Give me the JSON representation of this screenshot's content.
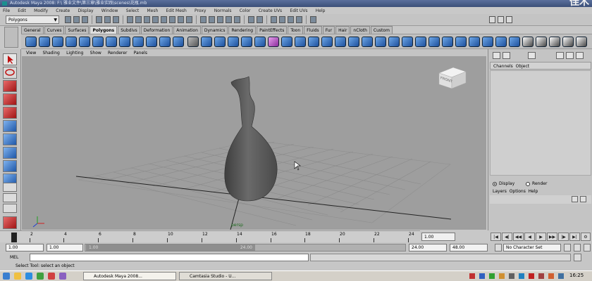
{
  "window": {
    "title": "Autodesk Maya 2008: F:\\ 雅业文件\\第三章\\雅业实践\\scenes\\花瓶.mb",
    "watermark": "佳木"
  },
  "menubar": [
    "File",
    "Edit",
    "Modify",
    "Create",
    "Display",
    "Window",
    "Select",
    "Mesh",
    "Edit Mesh",
    "Proxy",
    "Normals",
    "Color",
    "Create UVs",
    "Edit UVs",
    "Help"
  ],
  "statusline": {
    "menuset": "Polygons"
  },
  "shelf_tabs": [
    "General",
    "Curves",
    "Surfaces",
    "Polygons",
    "Subdivs",
    "Deformation",
    "Animation",
    "Dynamics",
    "Rendering",
    "PaintEffects",
    "Toon",
    "Fluids",
    "Fur",
    "Hair",
    "nCloth",
    "Custom"
  ],
  "shelf_active_tab": "Polygons",
  "panel_menu": [
    "View",
    "Shading",
    "Lighting",
    "Show",
    "Renderer",
    "Panels"
  ],
  "viewport": {
    "camera_name": "persp",
    "viewcube_label": "FRONT"
  },
  "channel_box": {
    "menu": [
      "Channels",
      "Object"
    ],
    "layer_modes": [
      "Display",
      "Render"
    ],
    "layer_mode_selected": "Display",
    "layer_menu": [
      "Layers",
      "Options",
      "Help"
    ]
  },
  "time_slider": {
    "tick_labels": [
      "2",
      "4",
      "6",
      "8",
      "10",
      "12",
      "14",
      "16",
      "18",
      "20",
      "22",
      "24"
    ],
    "current_frame": "1.00"
  },
  "range_slider": {
    "start_time": "1.00",
    "playback_start": "1.00",
    "handle_start": "1.00",
    "handle_end": "24.00",
    "playback_end": "24.00",
    "end_time": "48.00",
    "character_set": "No Character Set"
  },
  "command_line": {
    "label": "MEL"
  },
  "help_line": "Select Tool: select an object",
  "taskbar": {
    "tasks": [
      "Autodesk Maya 2008...",
      "Camtasia Studio - U..."
    ],
    "clock": "16:25"
  }
}
